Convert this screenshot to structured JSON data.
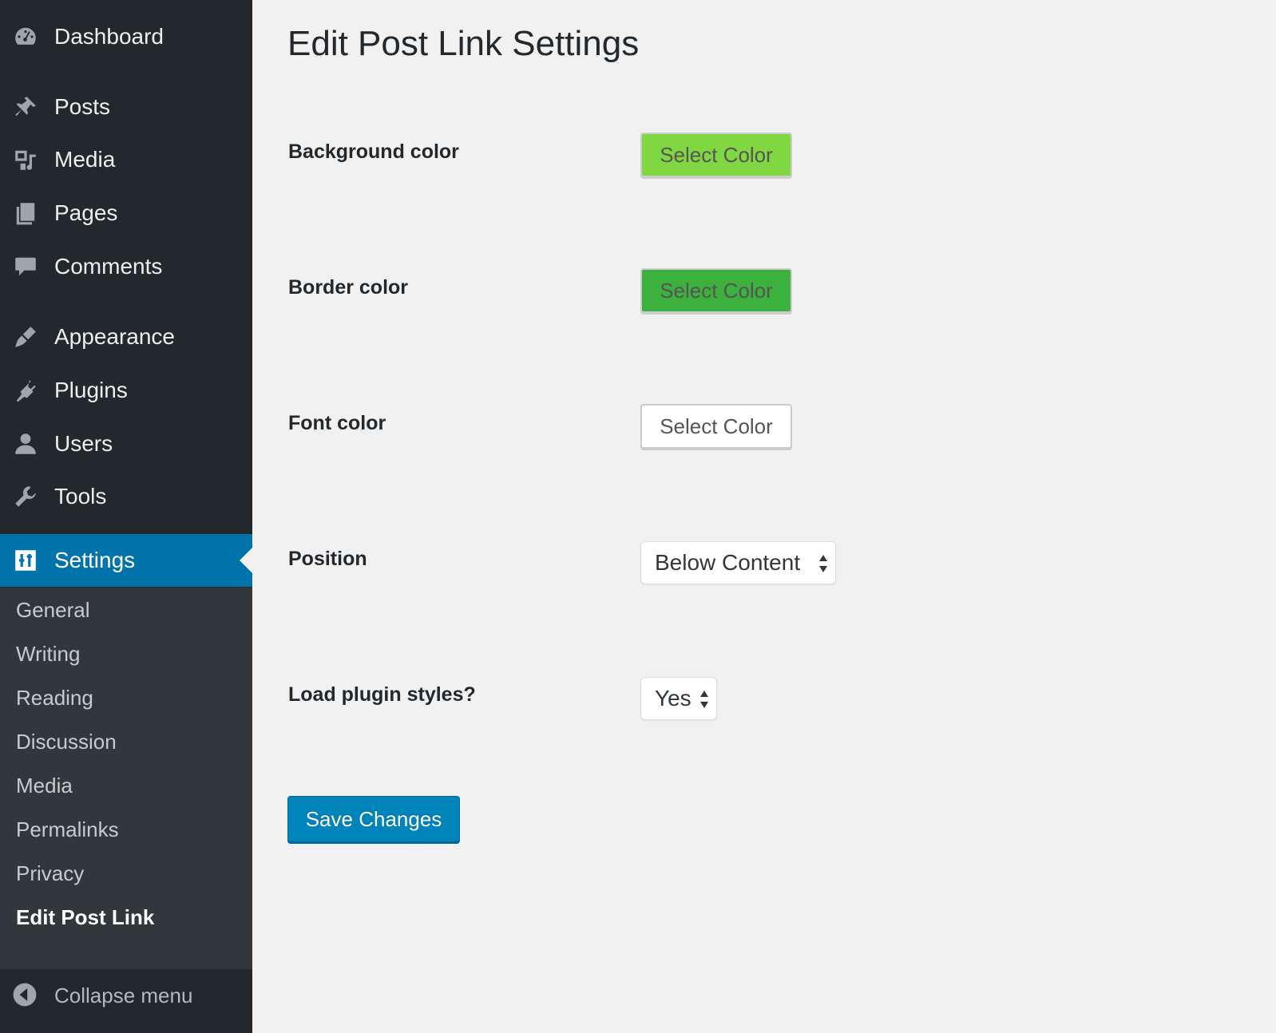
{
  "sidebar": {
    "items": [
      {
        "label": "Dashboard",
        "icon": "dashboard-icon"
      },
      {
        "label": "Posts",
        "icon": "pushpin-icon"
      },
      {
        "label": "Media",
        "icon": "media-icon"
      },
      {
        "label": "Pages",
        "icon": "pages-icon"
      },
      {
        "label": "Comments",
        "icon": "comment-icon"
      },
      {
        "label": "Appearance",
        "icon": "paintbrush-icon"
      },
      {
        "label": "Plugins",
        "icon": "plugin-icon"
      },
      {
        "label": "Users",
        "icon": "user-icon"
      },
      {
        "label": "Tools",
        "icon": "wrench-icon"
      },
      {
        "label": "Settings",
        "icon": "settings-icon",
        "active": true
      }
    ],
    "submenu": [
      "General",
      "Writing",
      "Reading",
      "Discussion",
      "Media",
      "Permalinks",
      "Privacy",
      "Edit Post Link"
    ],
    "current_submenu": "Edit Post Link",
    "collapse_label": "Collapse menu"
  },
  "page": {
    "title": "Edit Post Link Settings",
    "fields": {
      "background_color": {
        "label": "Background color",
        "button_label": "Select Color",
        "color": "#81d742"
      },
      "border_color": {
        "label": "Border color",
        "button_label": "Select Color",
        "color": "#3db13d"
      },
      "font_color": {
        "label": "Font color",
        "button_label": "Select Color",
        "color": "#ffffff"
      },
      "position": {
        "label": "Position",
        "selected": "Below Content"
      },
      "load_styles": {
        "label": "Load plugin styles?",
        "selected": "Yes"
      }
    },
    "save_label": "Save Changes"
  },
  "colors": {
    "sidebar_bg": "#23282d",
    "submenu_bg": "#32373c",
    "accent": "#0073aa",
    "button_primary": "#0085ba"
  }
}
